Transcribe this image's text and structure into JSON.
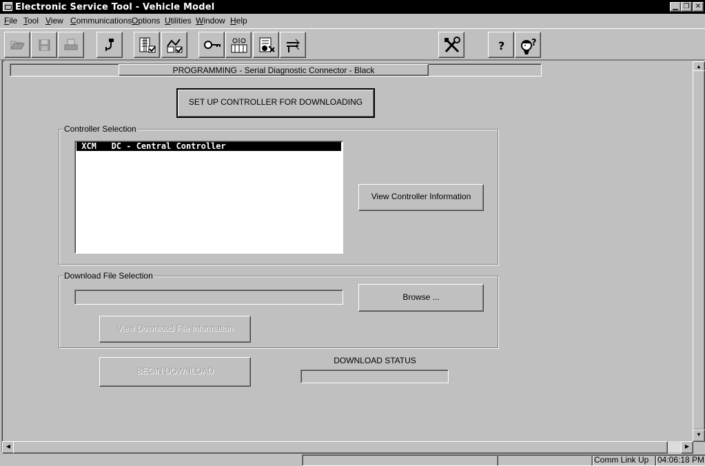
{
  "window": {
    "title": "Electronic Service Tool - Vehicle Model"
  },
  "menu": [
    "File",
    "Tool",
    "View",
    "Communications",
    "Options",
    "Utilities",
    "Window",
    "Help"
  ],
  "toolbar": {
    "buttons": [
      "open-icon",
      "save-icon",
      "print-icon",
      "connect-icon",
      "ecm-summary-icon",
      "status-check-icon",
      "key-icon",
      "diagnostic-tests-icon",
      "configuration-icon",
      "flash-program-icon",
      "tools-icon",
      "help-icon",
      "whats-this-help-icon"
    ]
  },
  "header": {
    "text": "PROGRAMMING  -  Serial Diagnostic Connector - Black"
  },
  "setup_button": "SET UP CONTROLLER FOR DOWNLOADING",
  "controller_selection": {
    "label": "Controller Selection",
    "items": [
      {
        "text": " XCM   DC - Central Controller",
        "selected": true
      }
    ],
    "view_info_button": "View Controller Information"
  },
  "download_file_selection": {
    "label": "Download File Selection",
    "file_value": "",
    "browse_button": "Browse ...",
    "view_file_info_button": "View Download File Information"
  },
  "begin_download_button": "BEGIN DOWNLOAD",
  "download_status": {
    "label": "DOWNLOAD STATUS",
    "value": ""
  },
  "statusbar": {
    "comm": "Comm Link Up",
    "time": "04:06:18 PM"
  }
}
